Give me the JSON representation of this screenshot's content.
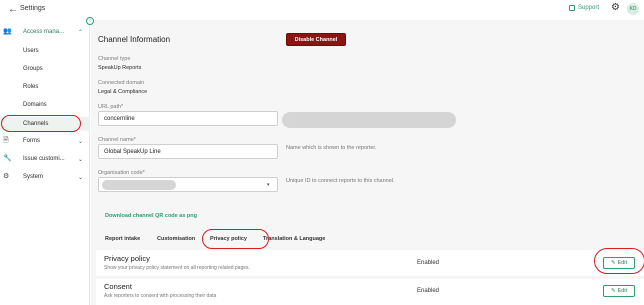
{
  "topbar": {
    "back_icon": "←",
    "title": "Settings",
    "support_label": "Support",
    "avatar_initials": "KD"
  },
  "sidebar": {
    "collapse_icon": "‹",
    "items": [
      {
        "label": "Access mana...",
        "icon": "👥",
        "chevron": "⌃"
      },
      {
        "label": "Users"
      },
      {
        "label": "Groups"
      },
      {
        "label": "Roles"
      },
      {
        "label": "Domains"
      },
      {
        "label": "Channels"
      },
      {
        "label": "Forms",
        "icon": "🗎",
        "chevron": "⌄"
      },
      {
        "label": "Issue customi...",
        "icon": "🔧",
        "chevron": "⌄"
      },
      {
        "label": "System",
        "icon": "⚙",
        "chevron": "⌄"
      }
    ]
  },
  "main": {
    "title": "Channel Information",
    "disable_button": "Disable Channel",
    "channel_type_label": "Channel type",
    "channel_type_value": "SpeakUp Reports",
    "connected_domain_label": "Connected domain",
    "connected_domain_value": "Legal & Compliance",
    "url_path_label": "URL path*",
    "url_path_value": "concernline",
    "channel_name_label": "Channel name*",
    "channel_name_value": "Global SpeakUp Line",
    "channel_name_hint": "Name which is shown to the reporter.",
    "org_code_label": "Organisation code*",
    "org_code_hint": "Unique ID to connect reports to this channel.",
    "select_arrow": "▾",
    "qr_link": "Download channel QR code as png",
    "tabs": [
      "Report intake",
      "Customisation",
      "Privacy policy",
      "Translation & Language"
    ],
    "rows": [
      {
        "title": "Privacy policy",
        "desc": "Show your privacy policy statement on all reporting related pages.",
        "status": "Enabled",
        "edit": "Edit"
      },
      {
        "title": "Consent",
        "desc": "Ask reporters to consent with processing their data",
        "status": "Enabled",
        "edit": "Edit"
      }
    ]
  },
  "colors": {
    "accent": "#2e9e6e",
    "danger": "#8b1414",
    "highlight_circle": "#d51f1f"
  }
}
